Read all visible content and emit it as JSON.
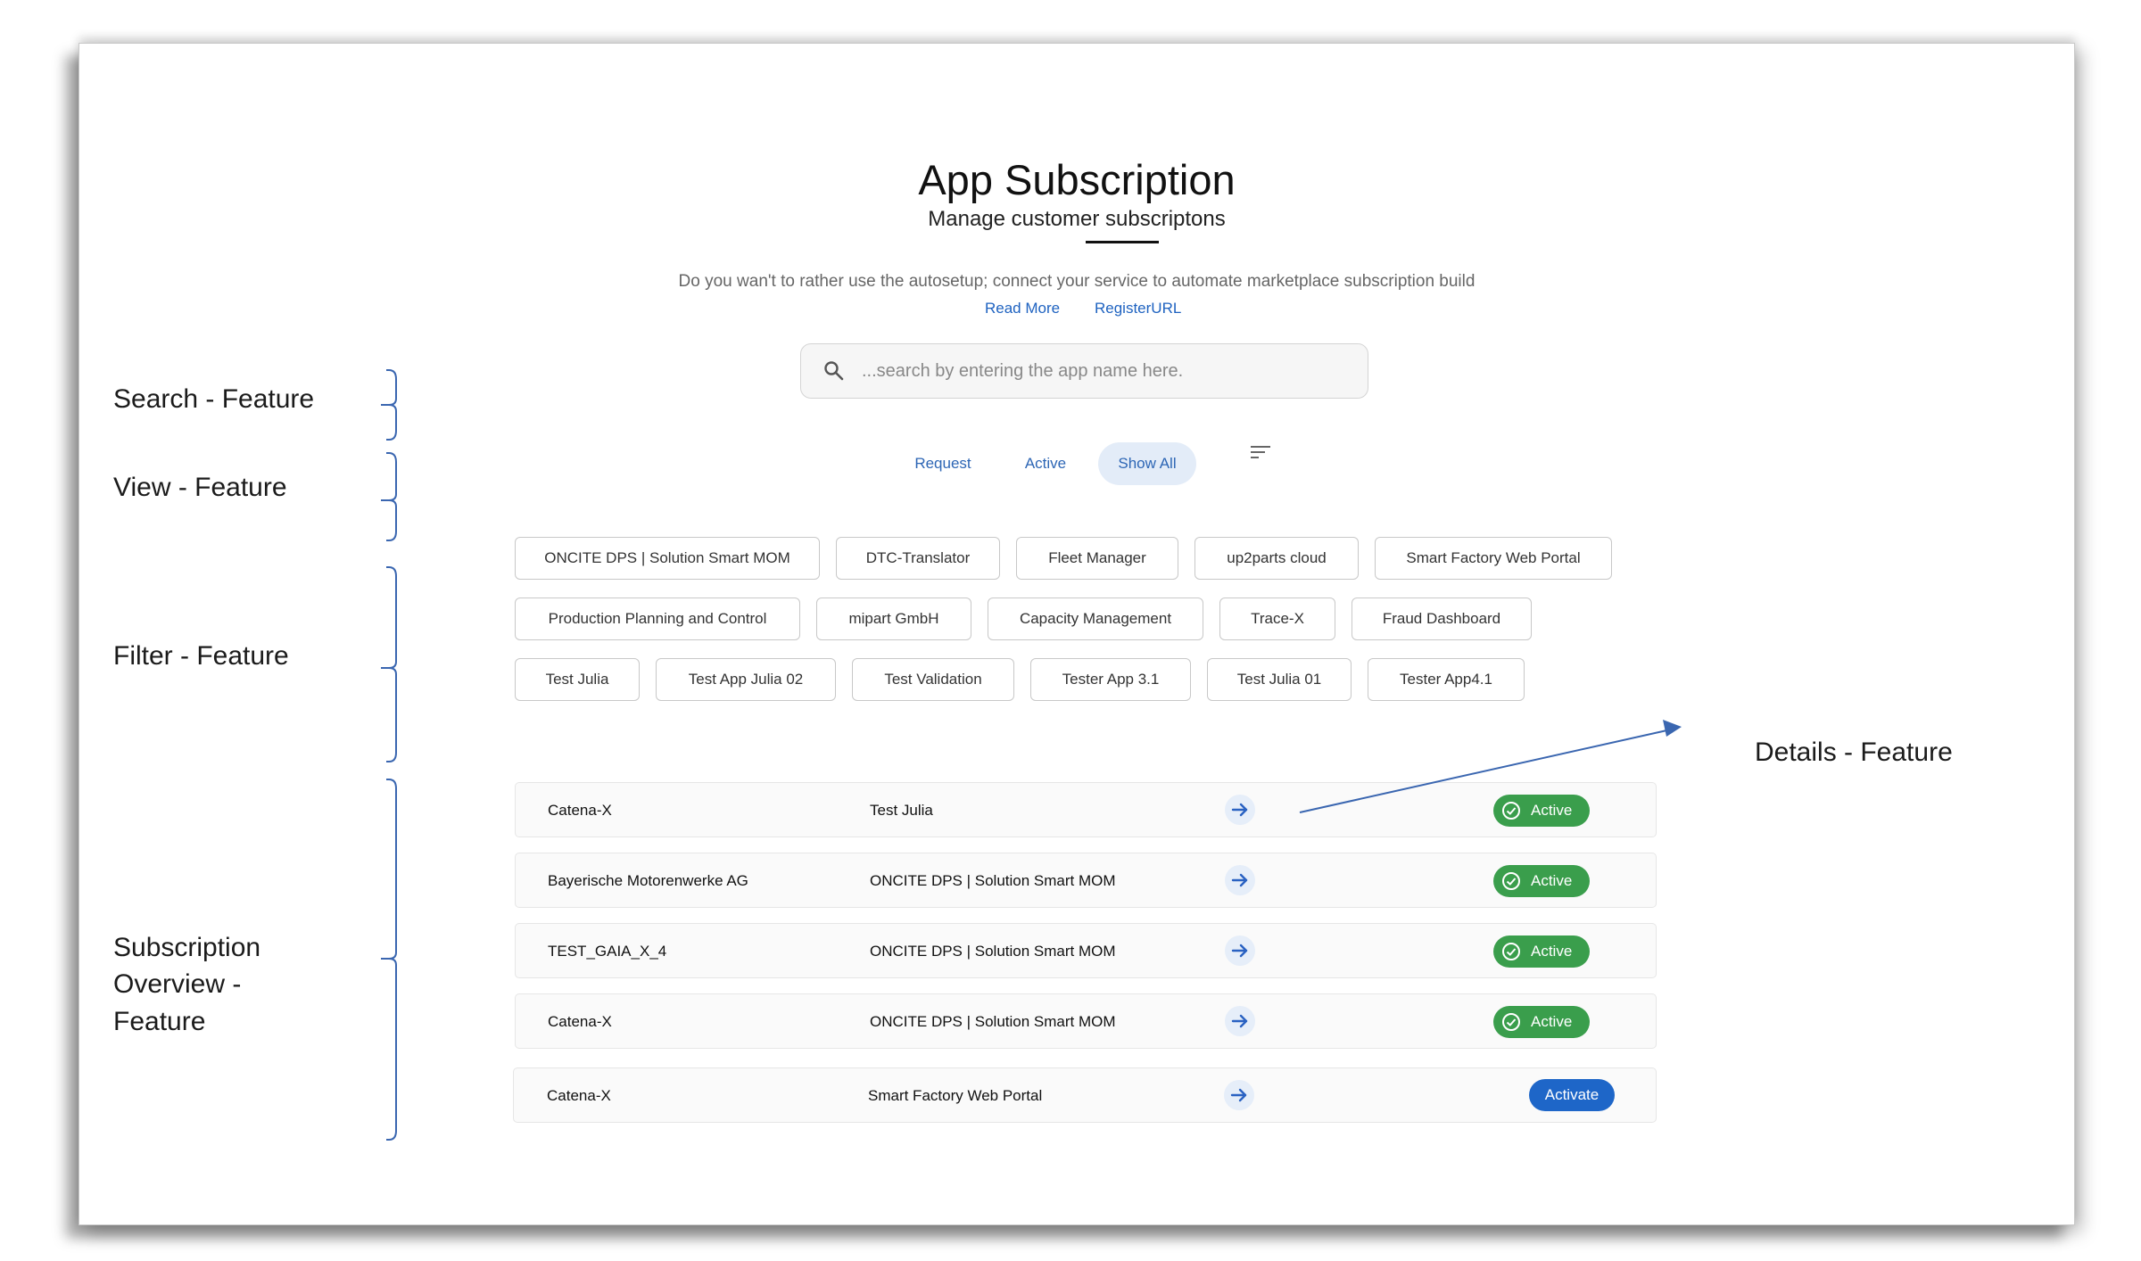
{
  "header": {
    "title": "App Subscription",
    "subtitle": "Manage customer subscriptons",
    "info_text": "Do you wan't to rather use the autosetup; connect your service to automate marketplace subscription build",
    "read_more": "Read More",
    "register_url": "RegisterURL"
  },
  "search": {
    "placeholder": "...search by entering the app name here.",
    "icon": "search-icon"
  },
  "view_tabs": [
    {
      "label": "Request",
      "selected": false
    },
    {
      "label": "Active",
      "selected": false
    },
    {
      "label": "Show All",
      "selected": true
    }
  ],
  "sort_icon": "sort-icon",
  "filters": [
    [
      "ONCITE DPS | Solution Smart MOM",
      "DTC-Translator",
      "Fleet Manager",
      "up2parts cloud",
      "Smart Factory Web Portal"
    ],
    [
      "Production Planning and Control",
      "mipart GmbH",
      "Capacity Management",
      "Trace-X",
      "Fraud Dashboard"
    ],
    [
      "Test Julia",
      "Test App Julia 02",
      "Test Validation",
      "Tester App 3.1",
      "Test Julia 01",
      "Tester App4.1"
    ]
  ],
  "subscriptions": [
    {
      "company": "Catena-X",
      "app": "Test Julia",
      "status": "Active"
    },
    {
      "company": "Bayerische Motorenwerke AG",
      "app": "ONCITE DPS | Solution Smart MOM",
      "status": "Active"
    },
    {
      "company": "TEST_GAIA_X_4",
      "app": "ONCITE DPS | Solution Smart MOM",
      "status": "Active"
    },
    {
      "company": "Catena-X",
      "app": "ONCITE DPS | Solution Smart MOM",
      "status": "Active"
    },
    {
      "company": "Catena-X",
      "app": "Smart Factory Web Portal",
      "status": "Activate"
    }
  ],
  "annotations": {
    "search": "Search - Feature",
    "view": "View - Feature",
    "filter": "Filter - Feature",
    "overview": [
      "Subscription",
      "Overview -",
      "Feature"
    ],
    "details": "Details - Feature"
  },
  "colors": {
    "accent": "#1e62c0",
    "active_badge": "#3a9e4c",
    "activate_button": "#1e66c8",
    "annotation_line": "#3a66b0"
  }
}
